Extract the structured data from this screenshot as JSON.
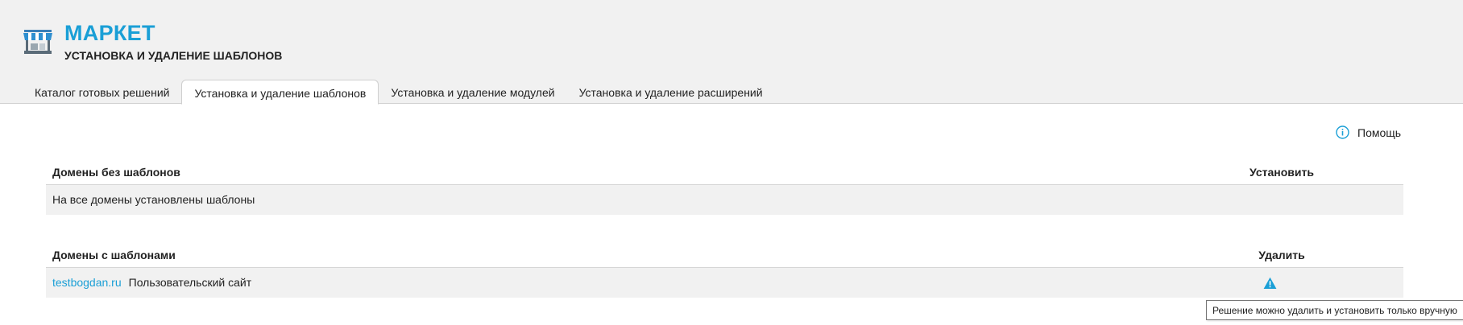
{
  "header": {
    "title": "МАРКЕТ",
    "subtitle": "УСТАНОВКА И УДАЛЕНИЕ ШАБЛОНОВ",
    "icon": "market-stall-icon"
  },
  "tabs": [
    {
      "label": "Каталог готовых решений",
      "active": false
    },
    {
      "label": "Установка и удаление шаблонов",
      "active": true
    },
    {
      "label": "Установка и удаление модулей",
      "active": false
    },
    {
      "label": "Установка и удаление расширений",
      "active": false
    }
  ],
  "help": {
    "label": "Помощь",
    "icon": "info-circle-icon"
  },
  "domains_without_templates": {
    "header_left": "Домены без шаблонов",
    "header_right": "Установить",
    "message": "На все домены установлены шаблоны"
  },
  "domains_with_templates": {
    "header_left": "Домены с шаблонами",
    "header_right": "Удалить",
    "rows": [
      {
        "domain": "testbogdan.ru",
        "template": "Пользовательский сайт",
        "action_icon": "warning-triangle-icon"
      }
    ]
  },
  "tooltip": {
    "text": "Решение можно удалить и установить только вручную"
  },
  "colors": {
    "accent": "#1a9fd6",
    "header_bg": "#f1f1f1",
    "row_bg": "#f1f1f1",
    "border": "#cfcfcf"
  }
}
